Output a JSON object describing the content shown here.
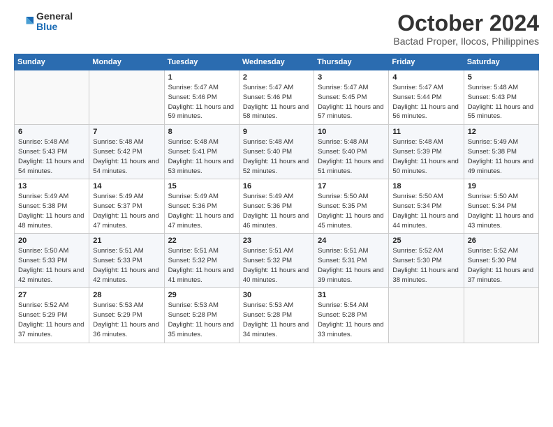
{
  "logo": {
    "general": "General",
    "blue": "Blue"
  },
  "title": "October 2024",
  "subtitle": "Bactad Proper, Ilocos, Philippines",
  "days_header": [
    "Sunday",
    "Monday",
    "Tuesday",
    "Wednesday",
    "Thursday",
    "Friday",
    "Saturday"
  ],
  "weeks": [
    [
      {
        "num": "",
        "info": ""
      },
      {
        "num": "",
        "info": ""
      },
      {
        "num": "1",
        "info": "Sunrise: 5:47 AM\nSunset: 5:46 PM\nDaylight: 11 hours and 59 minutes."
      },
      {
        "num": "2",
        "info": "Sunrise: 5:47 AM\nSunset: 5:46 PM\nDaylight: 11 hours and 58 minutes."
      },
      {
        "num": "3",
        "info": "Sunrise: 5:47 AM\nSunset: 5:45 PM\nDaylight: 11 hours and 57 minutes."
      },
      {
        "num": "4",
        "info": "Sunrise: 5:47 AM\nSunset: 5:44 PM\nDaylight: 11 hours and 56 minutes."
      },
      {
        "num": "5",
        "info": "Sunrise: 5:48 AM\nSunset: 5:43 PM\nDaylight: 11 hours and 55 minutes."
      }
    ],
    [
      {
        "num": "6",
        "info": "Sunrise: 5:48 AM\nSunset: 5:43 PM\nDaylight: 11 hours and 54 minutes."
      },
      {
        "num": "7",
        "info": "Sunrise: 5:48 AM\nSunset: 5:42 PM\nDaylight: 11 hours and 54 minutes."
      },
      {
        "num": "8",
        "info": "Sunrise: 5:48 AM\nSunset: 5:41 PM\nDaylight: 11 hours and 53 minutes."
      },
      {
        "num": "9",
        "info": "Sunrise: 5:48 AM\nSunset: 5:40 PM\nDaylight: 11 hours and 52 minutes."
      },
      {
        "num": "10",
        "info": "Sunrise: 5:48 AM\nSunset: 5:40 PM\nDaylight: 11 hours and 51 minutes."
      },
      {
        "num": "11",
        "info": "Sunrise: 5:48 AM\nSunset: 5:39 PM\nDaylight: 11 hours and 50 minutes."
      },
      {
        "num": "12",
        "info": "Sunrise: 5:49 AM\nSunset: 5:38 PM\nDaylight: 11 hours and 49 minutes."
      }
    ],
    [
      {
        "num": "13",
        "info": "Sunrise: 5:49 AM\nSunset: 5:38 PM\nDaylight: 11 hours and 48 minutes."
      },
      {
        "num": "14",
        "info": "Sunrise: 5:49 AM\nSunset: 5:37 PM\nDaylight: 11 hours and 47 minutes."
      },
      {
        "num": "15",
        "info": "Sunrise: 5:49 AM\nSunset: 5:36 PM\nDaylight: 11 hours and 47 minutes."
      },
      {
        "num": "16",
        "info": "Sunrise: 5:49 AM\nSunset: 5:36 PM\nDaylight: 11 hours and 46 minutes."
      },
      {
        "num": "17",
        "info": "Sunrise: 5:50 AM\nSunset: 5:35 PM\nDaylight: 11 hours and 45 minutes."
      },
      {
        "num": "18",
        "info": "Sunrise: 5:50 AM\nSunset: 5:34 PM\nDaylight: 11 hours and 44 minutes."
      },
      {
        "num": "19",
        "info": "Sunrise: 5:50 AM\nSunset: 5:34 PM\nDaylight: 11 hours and 43 minutes."
      }
    ],
    [
      {
        "num": "20",
        "info": "Sunrise: 5:50 AM\nSunset: 5:33 PM\nDaylight: 11 hours and 42 minutes."
      },
      {
        "num": "21",
        "info": "Sunrise: 5:51 AM\nSunset: 5:33 PM\nDaylight: 11 hours and 42 minutes."
      },
      {
        "num": "22",
        "info": "Sunrise: 5:51 AM\nSunset: 5:32 PM\nDaylight: 11 hours and 41 minutes."
      },
      {
        "num": "23",
        "info": "Sunrise: 5:51 AM\nSunset: 5:32 PM\nDaylight: 11 hours and 40 minutes."
      },
      {
        "num": "24",
        "info": "Sunrise: 5:51 AM\nSunset: 5:31 PM\nDaylight: 11 hours and 39 minutes."
      },
      {
        "num": "25",
        "info": "Sunrise: 5:52 AM\nSunset: 5:30 PM\nDaylight: 11 hours and 38 minutes."
      },
      {
        "num": "26",
        "info": "Sunrise: 5:52 AM\nSunset: 5:30 PM\nDaylight: 11 hours and 37 minutes."
      }
    ],
    [
      {
        "num": "27",
        "info": "Sunrise: 5:52 AM\nSunset: 5:29 PM\nDaylight: 11 hours and 37 minutes."
      },
      {
        "num": "28",
        "info": "Sunrise: 5:53 AM\nSunset: 5:29 PM\nDaylight: 11 hours and 36 minutes."
      },
      {
        "num": "29",
        "info": "Sunrise: 5:53 AM\nSunset: 5:28 PM\nDaylight: 11 hours and 35 minutes."
      },
      {
        "num": "30",
        "info": "Sunrise: 5:53 AM\nSunset: 5:28 PM\nDaylight: 11 hours and 34 minutes."
      },
      {
        "num": "31",
        "info": "Sunrise: 5:54 AM\nSunset: 5:28 PM\nDaylight: 11 hours and 33 minutes."
      },
      {
        "num": "",
        "info": ""
      },
      {
        "num": "",
        "info": ""
      }
    ]
  ]
}
